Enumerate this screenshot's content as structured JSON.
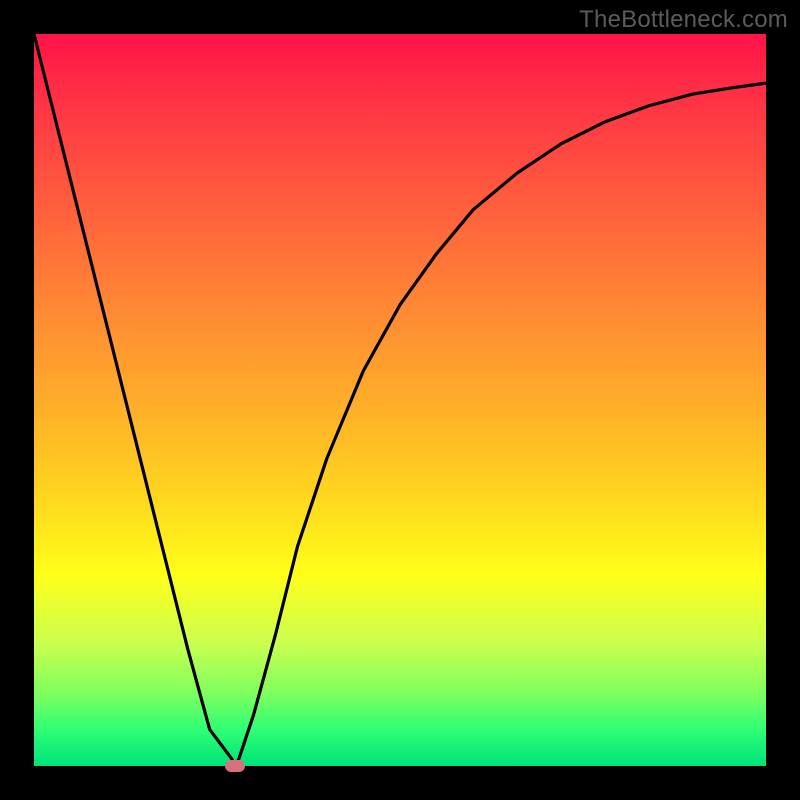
{
  "watermark": "TheBottleneck.com",
  "chart_data": {
    "type": "line",
    "title": "",
    "xlabel": "",
    "ylabel": "",
    "xlim": [
      0,
      100
    ],
    "ylim": [
      0,
      100
    ],
    "grid": false,
    "legend": false,
    "series": [
      {
        "name": "curve",
        "x": [
          0,
          3,
          6,
          9,
          12,
          15,
          18,
          21,
          24,
          27,
          27.5,
          28,
          30,
          33,
          36,
          40,
          45,
          50,
          55,
          60,
          66,
          72,
          78,
          84,
          90,
          95,
          100
        ],
        "y": [
          100,
          88,
          76,
          64,
          52,
          40,
          28,
          16,
          5,
          1,
          0,
          1,
          7,
          18,
          30,
          42,
          54,
          63,
          70,
          76,
          81,
          85,
          88,
          90.2,
          91.8,
          92.6,
          93.3
        ]
      }
    ],
    "marker": {
      "x": 27.5,
      "y": 0
    },
    "colors": {
      "curve": "#000000",
      "marker": "#d9717d",
      "gradient_stops": [
        "#ff1348",
        "#ff8a34",
        "#ffff1a",
        "#00e37a"
      ]
    }
  }
}
